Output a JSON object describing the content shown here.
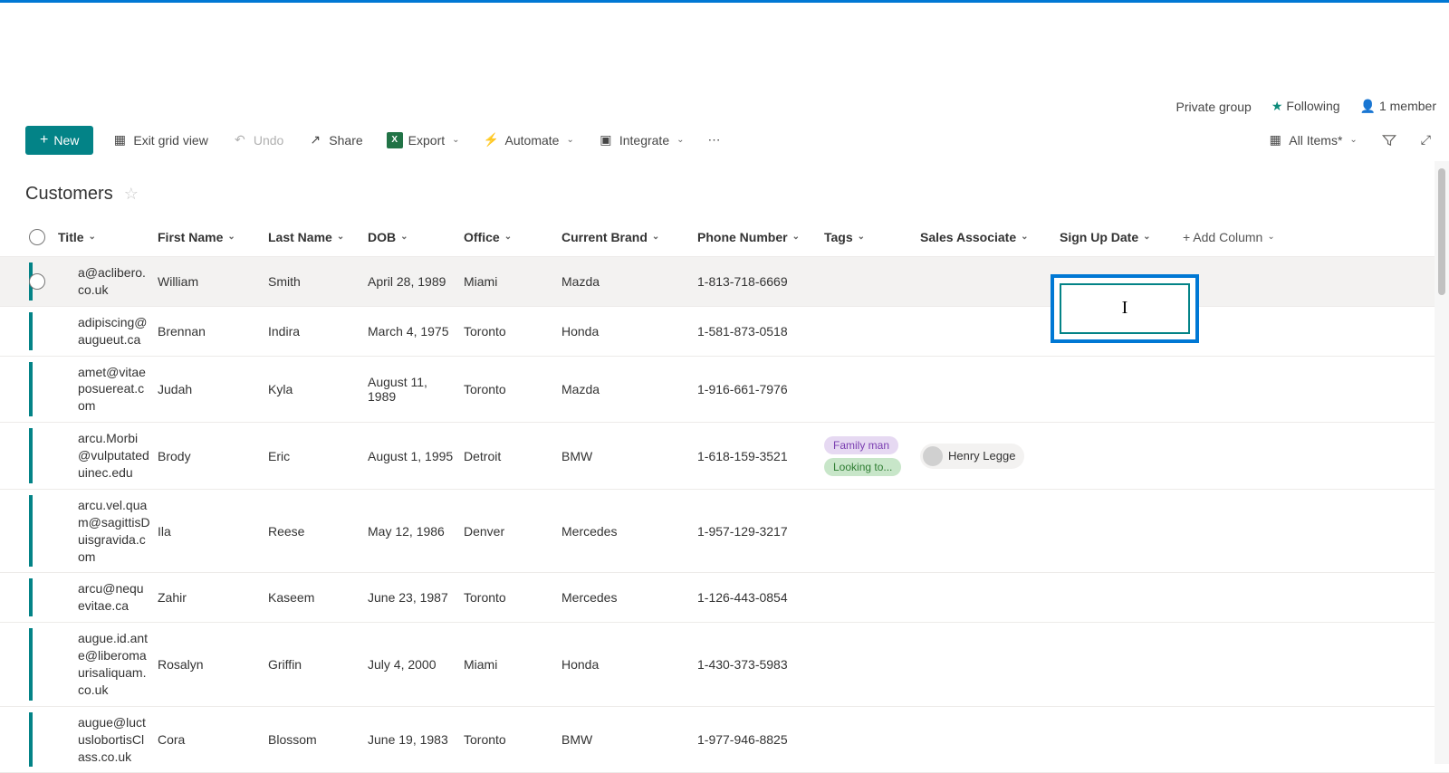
{
  "header": {
    "private_group": "Private group",
    "following": "Following",
    "members": "1 member"
  },
  "toolbar": {
    "new": "New",
    "exit_grid": "Exit grid view",
    "undo": "Undo",
    "share": "Share",
    "export": "Export",
    "automate": "Automate",
    "integrate": "Integrate",
    "all_items": "All Items*"
  },
  "list": {
    "title": "Customers"
  },
  "columns": {
    "title": "Title",
    "first_name": "First Name",
    "last_name": "Last Name",
    "dob": "DOB",
    "office": "Office",
    "current_brand": "Current Brand",
    "phone": "Phone Number",
    "tags": "Tags",
    "associate": "Sales Associate",
    "sign_up": "Sign Up Date",
    "add_column": "+ Add Column"
  },
  "rows": [
    {
      "title": "a@aclibero.co.uk",
      "first": "William",
      "last": "Smith",
      "dob": "April 28, 1989",
      "office": "Miami",
      "brand": "Mazda",
      "phone": "1-813-718-6669",
      "tags": [],
      "associate": "",
      "editing": true
    },
    {
      "title": "adipiscing@augueut.ca",
      "first": "Brennan",
      "last": "Indira",
      "dob": "March 4, 1975",
      "office": "Toronto",
      "brand": "Honda",
      "phone": "1-581-873-0518",
      "tags": [],
      "associate": ""
    },
    {
      "title": "amet@vitaeposuereat.com",
      "first": "Judah",
      "last": "Kyla",
      "dob": "August 11, 1989",
      "office": "Toronto",
      "brand": "Mazda",
      "phone": "1-916-661-7976",
      "tags": [],
      "associate": ""
    },
    {
      "title": "arcu.Morbi@vulputateduinec.edu",
      "first": "Brody",
      "last": "Eric",
      "dob": "August 1, 1995",
      "office": "Detroit",
      "brand": "BMW",
      "phone": "1-618-159-3521",
      "tags": [
        "Family man",
        "Looking to..."
      ],
      "associate": "Henry Legge"
    },
    {
      "title": "arcu.vel.quam@sagittisDuisgravida.com",
      "first": "Ila",
      "last": "Reese",
      "dob": "May 12, 1986",
      "office": "Denver",
      "brand": "Mercedes",
      "phone": "1-957-129-3217",
      "tags": [],
      "associate": ""
    },
    {
      "title": "arcu@nequevitae.ca",
      "first": "Zahir",
      "last": "Kaseem",
      "dob": "June 23, 1987",
      "office": "Toronto",
      "brand": "Mercedes",
      "phone": "1-126-443-0854",
      "tags": [],
      "associate": ""
    },
    {
      "title": "augue.id.ante@liberomaurisaliquam.co.uk",
      "first": "Rosalyn",
      "last": "Griffin",
      "dob": "July 4, 2000",
      "office": "Miami",
      "brand": "Honda",
      "phone": "1-430-373-5983",
      "tags": [],
      "associate": ""
    },
    {
      "title": "augue@luctuslobortisClass.co.uk",
      "first": "Cora",
      "last": "Blossom",
      "dob": "June 19, 1983",
      "office": "Toronto",
      "brand": "BMW",
      "phone": "1-977-946-8825",
      "tags": [],
      "associate": ""
    }
  ],
  "tag_colors": {
    "Family man": "tag-purple",
    "Looking to...": "tag-green"
  }
}
